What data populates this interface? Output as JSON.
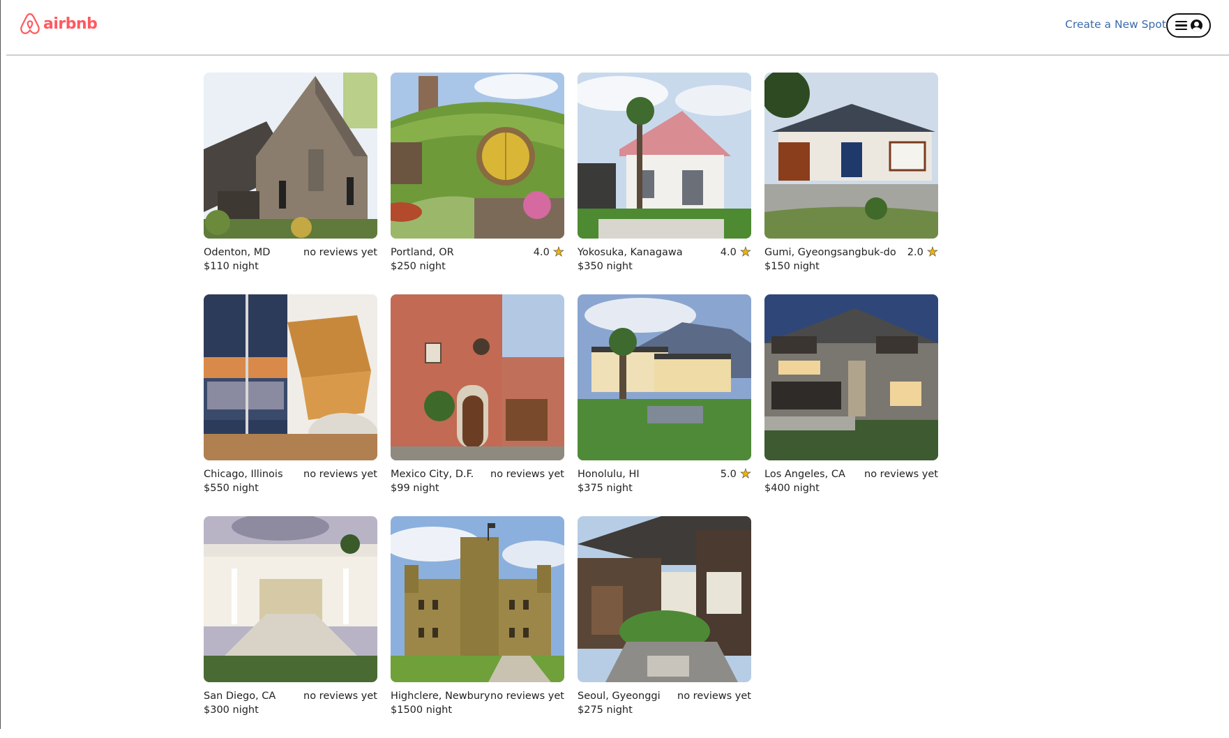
{
  "header": {
    "logo_text": "airbnb",
    "create_link": "Create a New Spot",
    "menu_icons": [
      "hamburger-icon",
      "user-icon"
    ]
  },
  "colors": {
    "brand": "#FF5A5F",
    "link": "#3b6aa8",
    "star": "#f4b400"
  },
  "spots": [
    {
      "location": "Odenton, MD",
      "rating": "no reviews yet",
      "has_star": false,
      "price": "$110 night",
      "scene": "stone-cottage"
    },
    {
      "location": "Portland, OR",
      "rating": "4.0",
      "has_star": true,
      "price": "$250 night",
      "scene": "hobbit-hole"
    },
    {
      "location": "Yokosuka, Kanagawa",
      "rating": "4.0",
      "has_star": true,
      "price": "$350 night",
      "scene": "gabled-house"
    },
    {
      "location": "Gumi, Gyeongsangbuk-do",
      "rating": "2.0",
      "has_star": true,
      "price": "$150 night",
      "scene": "korean-house"
    },
    {
      "location": "Chicago, Illinois",
      "rating": "no reviews yet",
      "has_star": false,
      "price": "$550 night",
      "scene": "city-stairs"
    },
    {
      "location": "Mexico City, D.F.",
      "rating": "no reviews yet",
      "has_star": false,
      "price": "$99 night",
      "scene": "hacienda"
    },
    {
      "location": "Honolulu, HI",
      "rating": "5.0",
      "has_star": true,
      "price": "$375 night",
      "scene": "tropical-villa"
    },
    {
      "location": "Los Angeles, CA",
      "rating": "no reviews yet",
      "has_star": false,
      "price": "$400 night",
      "scene": "modern-house"
    },
    {
      "location": "San Diego, CA",
      "rating": "no reviews yet",
      "has_star": false,
      "price": "$300 night",
      "scene": "white-mansion"
    },
    {
      "location": "Highclere, Newbury",
      "rating": "no reviews yet",
      "has_star": false,
      "price": "$1500 night",
      "scene": "castle"
    },
    {
      "location": "Seoul, Gyeonggi",
      "rating": "no reviews yet",
      "has_star": false,
      "price": "$275 night",
      "scene": "hanok-courtyard"
    }
  ]
}
